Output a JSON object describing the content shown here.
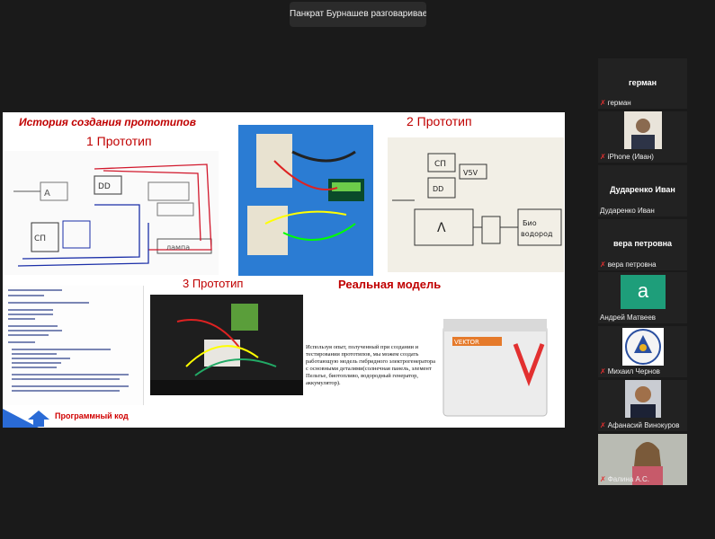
{
  "speaker_toast": "Панкрат Бурнашев разговаривает...",
  "slide": {
    "history_title": "История создания прототипов",
    "prototype1": "1 Прототип",
    "prototype2": "2 Прототип",
    "prototype3": "3 Прототип",
    "real_model": "Реальная модель",
    "code_label": "Программный код",
    "description": "Используя опыт, полученный при создании и тестировании прототипов, мы можем создать работающую модель гибридного электрогенератора с основными деталями(солнечная панель, элемент Пельтье, биотопливо, водородный генератор, аккумулятор)."
  },
  "participants": [
    {
      "name_large": "герман",
      "label": "герман",
      "muted": true
    },
    {
      "label": "iPhone (Иван)",
      "muted": true
    },
    {
      "name_large": "Дударенко Иван",
      "label": "Дударенко Иван",
      "muted": false
    },
    {
      "name_large": "вера петровна",
      "label": "вера петровна",
      "muted": true
    },
    {
      "avatar_letter": "а",
      "label": "Андрей Матвеев",
      "muted": false
    },
    {
      "label": "Михаил Чернов",
      "muted": true
    },
    {
      "label": "Афанасий Винокуров",
      "muted": true
    },
    {
      "label": "Фалина А.С.",
      "muted": true
    }
  ],
  "colors": {
    "accent_green": "#1e9e7a",
    "mic_red": "#e23030",
    "title_red": "#c00000"
  }
}
